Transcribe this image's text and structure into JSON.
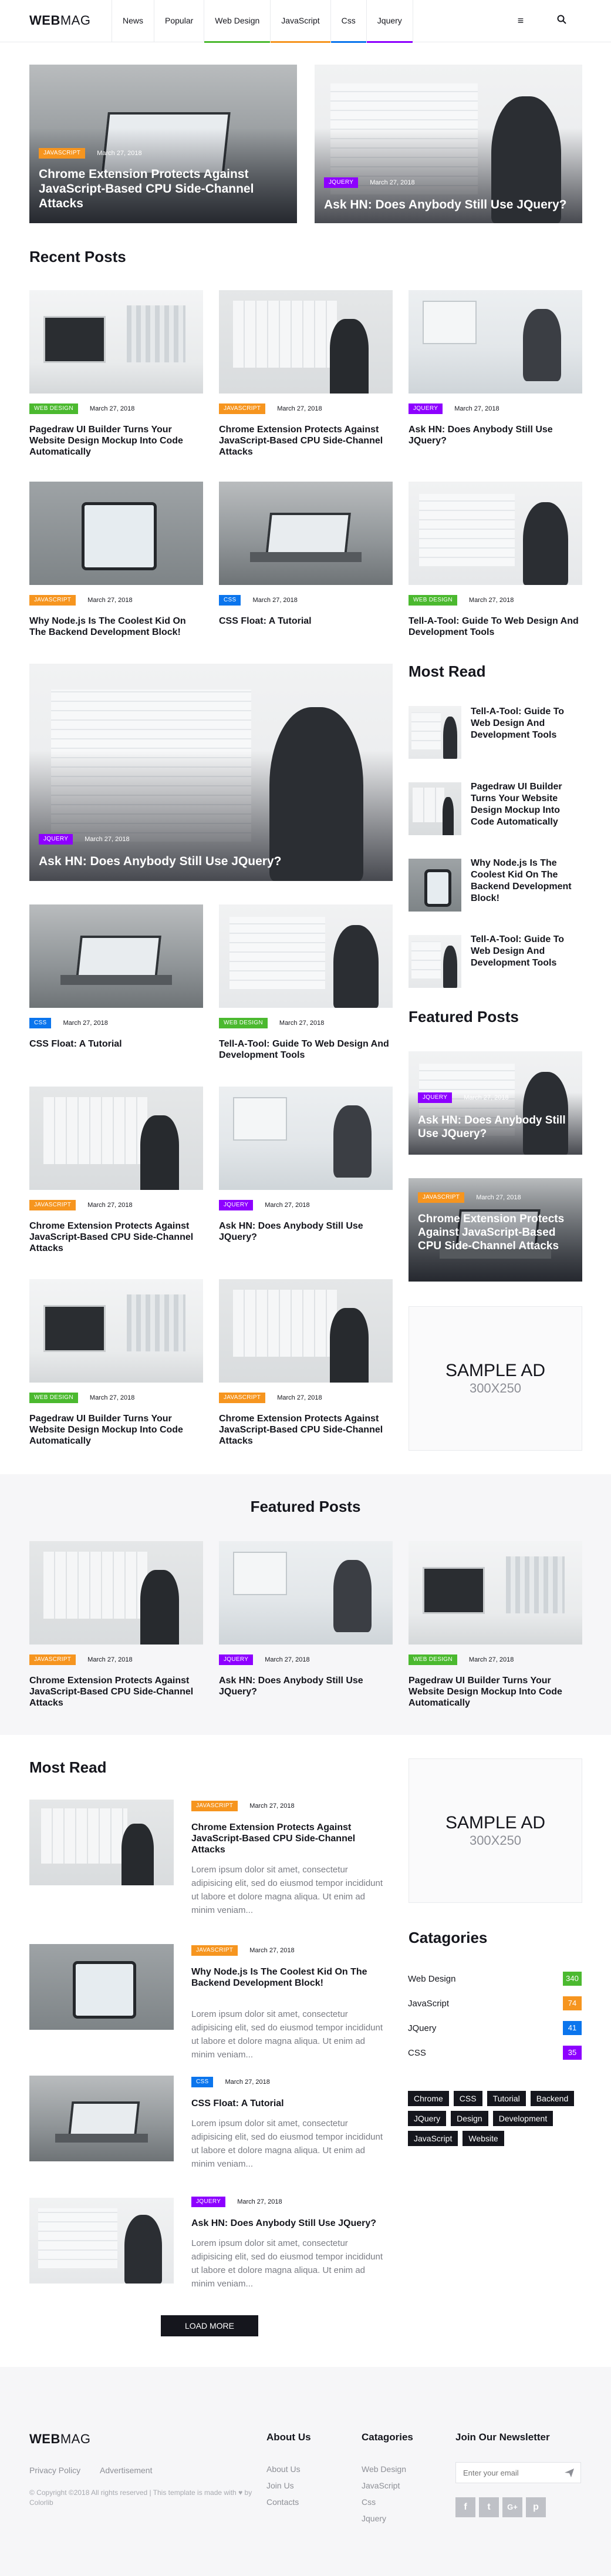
{
  "colors": {
    "javascript": "#f6951f",
    "jquery": "#8d00ff",
    "webdesign": "#4bb92f",
    "css": "#0b75ed",
    "dark": "#15161d",
    "muted": "#8d8f96"
  },
  "header": {
    "logo_bold": "WEB",
    "logo_rest": "MAG",
    "nav": [
      "News",
      "Popular",
      "Web Design",
      "JavaScript",
      "Css",
      "Jquery"
    ],
    "menu_icon": "hamburger-icon",
    "search_icon": "search-icon"
  },
  "hero": [
    {
      "tag": "JAVASCRIPT",
      "date": "March 27, 2018",
      "title": "Chrome Extension Protects Against JavaScript-Based CPU Side-Channel Attacks"
    },
    {
      "tag": "JQUERY",
      "date": "March 27, 2018",
      "title": "Ask HN: Does Anybody Still Use JQuery?"
    }
  ],
  "recent": {
    "heading": "Recent Posts",
    "posts": [
      {
        "tag": "WEB DESIGN",
        "date": "March 27, 2018",
        "title": "Pagedraw UI Builder Turns Your Website Design Mockup Into Code Automatically"
      },
      {
        "tag": "JAVASCRIPT",
        "date": "March 27, 2018",
        "title": "Chrome Extension Protects Against JavaScript-Based CPU Side-Channel Attacks"
      },
      {
        "tag": "JQUERY",
        "date": "March 27, 2018",
        "title": "Ask HN: Does Anybody Still Use JQuery?"
      },
      {
        "tag": "JAVASCRIPT",
        "date": "March 27, 2018",
        "title": "Why Node.js Is The Coolest Kid On The Backend Development Block!"
      },
      {
        "tag": "CSS",
        "date": "March 27, 2018",
        "title": "CSS Float: A Tutorial"
      },
      {
        "tag": "WEB DESIGN",
        "date": "March 27, 2018",
        "title": "Tell-A-Tool: Guide To Web Design And Development Tools"
      }
    ],
    "big": {
      "tag": "JQUERY",
      "date": "March 27, 2018",
      "title": "Ask HN: Does Anybody Still Use JQuery?"
    },
    "grid2": [
      {
        "tag": "CSS",
        "date": "March 27, 2018",
        "title": "CSS Float: A Tutorial"
      },
      {
        "tag": "WEB DESIGN",
        "date": "March 27, 2018",
        "title": "Tell-A-Tool: Guide To Web Design And Development Tools"
      },
      {
        "tag": "JAVASCRIPT",
        "date": "March 27, 2018",
        "title": "Chrome Extension Protects Against JavaScript-Based CPU Side-Channel Attacks"
      },
      {
        "tag": "JQUERY",
        "date": "March 27, 2018",
        "title": "Ask HN: Does Anybody Still Use JQuery?"
      },
      {
        "tag": "WEB DESIGN",
        "date": "March 27, 2018",
        "title": "Pagedraw UI Builder Turns Your Website Design Mockup Into Code Automatically"
      },
      {
        "tag": "JAVASCRIPT",
        "date": "March 27, 2018",
        "title": "Chrome Extension Protects Against JavaScript-Based CPU Side-Channel Attacks"
      }
    ]
  },
  "sidebar_most_read": {
    "heading": "Most Read",
    "items": [
      "Tell-A-Tool: Guide To Web Design And Development Tools",
      "Pagedraw UI Builder Turns Your Website Design Mockup Into Code Automatically",
      "Why Node.js Is The Coolest Kid On The Backend Development Block!",
      "Tell-A-Tool: Guide To Web Design And Development Tools"
    ]
  },
  "sidebar_featured": {
    "heading": "Featured Posts",
    "items": [
      {
        "tag": "JQUERY",
        "date": "March 27, 2018",
        "title": "Ask HN: Does Anybody Still Use JQuery?"
      },
      {
        "tag": "JAVASCRIPT",
        "date": "March 27, 2018",
        "title": "Chrome Extension Protects Against JavaScript-Based CPU Side-Channel Attacks"
      }
    ]
  },
  "ad": {
    "title": "SAMPLE AD",
    "size": "300X250"
  },
  "featured": {
    "heading": "Featured Posts",
    "posts": [
      {
        "tag": "JAVASCRIPT",
        "date": "March 27, 2018",
        "title": "Chrome Extension Protects Against JavaScript-Based CPU Side-Channel Attacks"
      },
      {
        "tag": "JQUERY",
        "date": "March 27, 2018",
        "title": "Ask HN: Does Anybody Still Use JQuery?"
      },
      {
        "tag": "WEB DESIGN",
        "date": "March 27, 2018",
        "title": "Pagedraw UI Builder Turns Your Website Design Mockup Into Code Automatically"
      }
    ]
  },
  "most_read": {
    "heading": "Most Read",
    "excerpt": "Lorem ipsum dolor sit amet, consectetur adipisicing elit, sed do eiusmod tempor incididunt ut labore et dolore magna aliqua. Ut enim ad minim veniam...",
    "posts": [
      {
        "tag": "JAVASCRIPT",
        "date": "March 27, 2018",
        "title": "Chrome Extension Protects Against JavaScript-Based CPU Side-Channel Attacks"
      },
      {
        "tag": "JAVASCRIPT",
        "date": "March 27, 2018",
        "title": "Why Node.js Is The Coolest Kid On The Backend Development Block!"
      },
      {
        "tag": "CSS",
        "date": "March 27, 2018",
        "title": "CSS Float: A Tutorial"
      },
      {
        "tag": "JQUERY",
        "date": "March 27, 2018",
        "title": "Ask HN: Does Anybody Still Use JQuery?"
      }
    ],
    "load_more": "LOAD MORE"
  },
  "categories": {
    "heading": "Catagories",
    "items": [
      {
        "name": "Web Design",
        "count": "340",
        "color": "#4bb92f"
      },
      {
        "name": "JavaScript",
        "count": "74",
        "color": "#f6951f"
      },
      {
        "name": "JQuery",
        "count": "41",
        "color": "#0b75ed"
      },
      {
        "name": "CSS",
        "count": "35",
        "color": "#8d00ff"
      }
    ]
  },
  "tags": [
    "Chrome",
    "CSS",
    "Tutorial",
    "Backend",
    "JQuery",
    "Design",
    "Development",
    "JavaScript",
    "Website"
  ],
  "footer": {
    "logo_bold": "WEB",
    "logo_rest": "MAG",
    "links": [
      "Privacy Policy",
      "Advertisement"
    ],
    "copyright": "© Copyright ©2018 All rights reserved | This template is made with ♥ by Colorlib",
    "about_heading": "About Us",
    "about_links": [
      "About Us",
      "Join Us",
      "Contacts"
    ],
    "cat_heading": "Catagories",
    "cat_links": [
      "Web Design",
      "JavaScript",
      "Css",
      "Jquery"
    ],
    "newsletter_heading": "Join Our Newsletter",
    "email_placeholder": "Enter your email",
    "social": [
      "f",
      "t",
      "G+",
      "p"
    ]
  }
}
